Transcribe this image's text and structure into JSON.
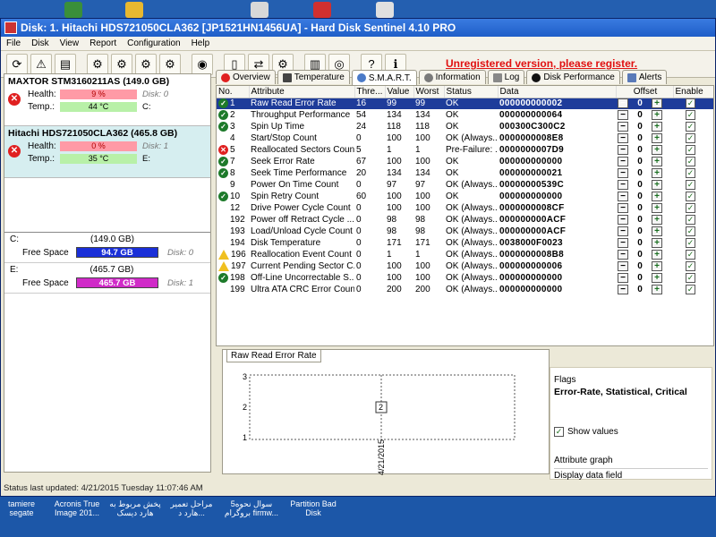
{
  "window": {
    "title": "Disk: 1. Hitachi HDS721050CLA362 [JP1521HN1456UA]  -  Hard Disk Sentinel 4.10 PRO"
  },
  "menu": [
    "File",
    "Disk",
    "View",
    "Report",
    "Configuration",
    "Help"
  ],
  "toolbar": {
    "unregistered_text": "Unregistered version, please register."
  },
  "disks": [
    {
      "name": "MAXTOR STM3160211AS (149.0 GB)",
      "health_label": "Health:",
      "health_value": "9 %",
      "health_pct": 9,
      "disk_label": "Disk: 0",
      "temp_label": "Temp.:",
      "temp_value": "44 °C",
      "drive": "C:"
    },
    {
      "name": "Hitachi HDS721050CLA362 (465.8 GB)",
      "health_label": "Health:",
      "health_value": "0 %",
      "health_pct": 0,
      "disk_label": "Disk: 1",
      "temp_label": "Temp.:",
      "temp_value": "35 °C",
      "drive": "E:"
    }
  ],
  "volumes": [
    {
      "letter": "C:",
      "size": "(149.0 GB)",
      "free_label": "Free Space",
      "free_value": "94.7 GB",
      "disk_label": "Disk: 0",
      "color": "#1a2fd8"
    },
    {
      "letter": "E:",
      "size": "(465.7 GB)",
      "free_label": "Free Space",
      "free_value": "465.7 GB",
      "disk_label": "Disk: 1",
      "color": "#d02ac8"
    }
  ],
  "tabs": [
    {
      "label": "Overview",
      "icon": "error-icon"
    },
    {
      "label": "Temperature",
      "icon": "thermometer-icon"
    },
    {
      "label": "S.M.A.R.T.",
      "icon": "smart-icon"
    },
    {
      "label": "Information",
      "icon": "info-icon"
    },
    {
      "label": "Log",
      "icon": "log-icon"
    },
    {
      "label": "Disk Performance",
      "icon": "performance-icon"
    },
    {
      "label": "Alerts",
      "icon": "alerts-icon"
    }
  ],
  "table": {
    "headers": [
      "No.",
      "Attribute",
      "Thre...",
      "Value",
      "Worst",
      "Status",
      "Data",
      "Offset",
      "Enable"
    ],
    "rows": [
      {
        "status_icon": "ok",
        "no": "1",
        "attr": "Raw Read Error Rate",
        "thr": "16",
        "val": "99",
        "worst": "99",
        "status": "OK",
        "data": "000000000002",
        "offset": "0"
      },
      {
        "status_icon": "ok",
        "no": "2",
        "attr": "Throughput Performance",
        "thr": "54",
        "val": "134",
        "worst": "134",
        "status": "OK",
        "data": "000000000064",
        "offset": "0"
      },
      {
        "status_icon": "ok",
        "no": "3",
        "attr": "Spin Up Time",
        "thr": "24",
        "val": "118",
        "worst": "118",
        "status": "OK",
        "data": "000300C300C2",
        "offset": "0"
      },
      {
        "status_icon": "none",
        "no": "4",
        "attr": "Start/Stop Count",
        "thr": "0",
        "val": "100",
        "worst": "100",
        "status": "OK (Always...",
        "data": "0000000008E8",
        "offset": "0"
      },
      {
        "status_icon": "err",
        "no": "5",
        "attr": "Reallocated Sectors Count",
        "thr": "5",
        "val": "1",
        "worst": "1",
        "status": "Pre-Failure: ...",
        "data": "0000000007D9",
        "offset": "0"
      },
      {
        "status_icon": "ok",
        "no": "7",
        "attr": "Seek Error Rate",
        "thr": "67",
        "val": "100",
        "worst": "100",
        "status": "OK",
        "data": "000000000000",
        "offset": "0"
      },
      {
        "status_icon": "ok",
        "no": "8",
        "attr": "Seek Time Performance",
        "thr": "20",
        "val": "134",
        "worst": "134",
        "status": "OK",
        "data": "000000000021",
        "offset": "0"
      },
      {
        "status_icon": "none",
        "no": "9",
        "attr": "Power On Time Count",
        "thr": "0",
        "val": "97",
        "worst": "97",
        "status": "OK (Always...",
        "data": "00000000539C",
        "offset": "0"
      },
      {
        "status_icon": "ok",
        "no": "10",
        "attr": "Spin Retry Count",
        "thr": "60",
        "val": "100",
        "worst": "100",
        "status": "OK",
        "data": "000000000000",
        "offset": "0"
      },
      {
        "status_icon": "none",
        "no": "12",
        "attr": "Drive Power Cycle Count",
        "thr": "0",
        "val": "100",
        "worst": "100",
        "status": "OK (Always...",
        "data": "0000000008CF",
        "offset": "0"
      },
      {
        "status_icon": "none",
        "no": "192",
        "attr": "Power off Retract Cycle ...",
        "thr": "0",
        "val": "98",
        "worst": "98",
        "status": "OK (Always...",
        "data": "000000000ACF",
        "offset": "0"
      },
      {
        "status_icon": "none",
        "no": "193",
        "attr": "Load/Unload Cycle Count",
        "thr": "0",
        "val": "98",
        "worst": "98",
        "status": "OK (Always...",
        "data": "000000000ACF",
        "offset": "0"
      },
      {
        "status_icon": "none",
        "no": "194",
        "attr": "Disk Temperature",
        "thr": "0",
        "val": "171",
        "worst": "171",
        "status": "OK (Always...",
        "data": "0038000F0023",
        "offset": "0"
      },
      {
        "status_icon": "warn",
        "no": "196",
        "attr": "Reallocation Event Count",
        "thr": "0",
        "val": "1",
        "worst": "1",
        "status": "OK (Always...",
        "data": "0000000008B8",
        "offset": "0"
      },
      {
        "status_icon": "warn",
        "no": "197",
        "attr": "Current Pending Sector C...",
        "thr": "0",
        "val": "100",
        "worst": "100",
        "status": "OK (Always...",
        "data": "000000000006",
        "offset": "0"
      },
      {
        "status_icon": "ok",
        "no": "198",
        "attr": "Off-Line Uncorrectable S...",
        "thr": "0",
        "val": "100",
        "worst": "100",
        "status": "OK (Always...",
        "data": "000000000000",
        "offset": "0"
      },
      {
        "status_icon": "none",
        "no": "199",
        "attr": "Ultra ATA CRC Error Count",
        "thr": "0",
        "val": "200",
        "worst": "200",
        "status": "OK (Always...",
        "data": "000000000000",
        "offset": "0"
      }
    ]
  },
  "graph": {
    "tab_label": "Raw Read Error Rate",
    "y_ticks": [
      "3",
      "2",
      "1"
    ],
    "x_label": "4/21/2015",
    "point_label": "2",
    "chart_data": {
      "type": "line",
      "x": [
        "4/21/2015"
      ],
      "series": [
        {
          "values": [
            2
          ]
        }
      ],
      "ylim": [
        1,
        3
      ]
    }
  },
  "flags": {
    "title": "Flags",
    "value": "Error-Rate, Statistical, Critical",
    "show_values": "Show values",
    "attribute_graph": "Attribute graph",
    "display_field": "Display data field"
  },
  "status_bar": "Status last updated: 4/21/2015 Tuesday 11:07:46 AM",
  "desktop": [
    {
      "label": "tamiere segate"
    },
    {
      "label": "Acronis True Image 201..."
    },
    {
      "label": "پخش مربوط به هارد دیسک"
    },
    {
      "label": "مراحل تعمیر هارد د..."
    },
    {
      "label": "5سوال نحوه بروگرام firmw..."
    },
    {
      "label": "Partition Bad Disk"
    }
  ]
}
